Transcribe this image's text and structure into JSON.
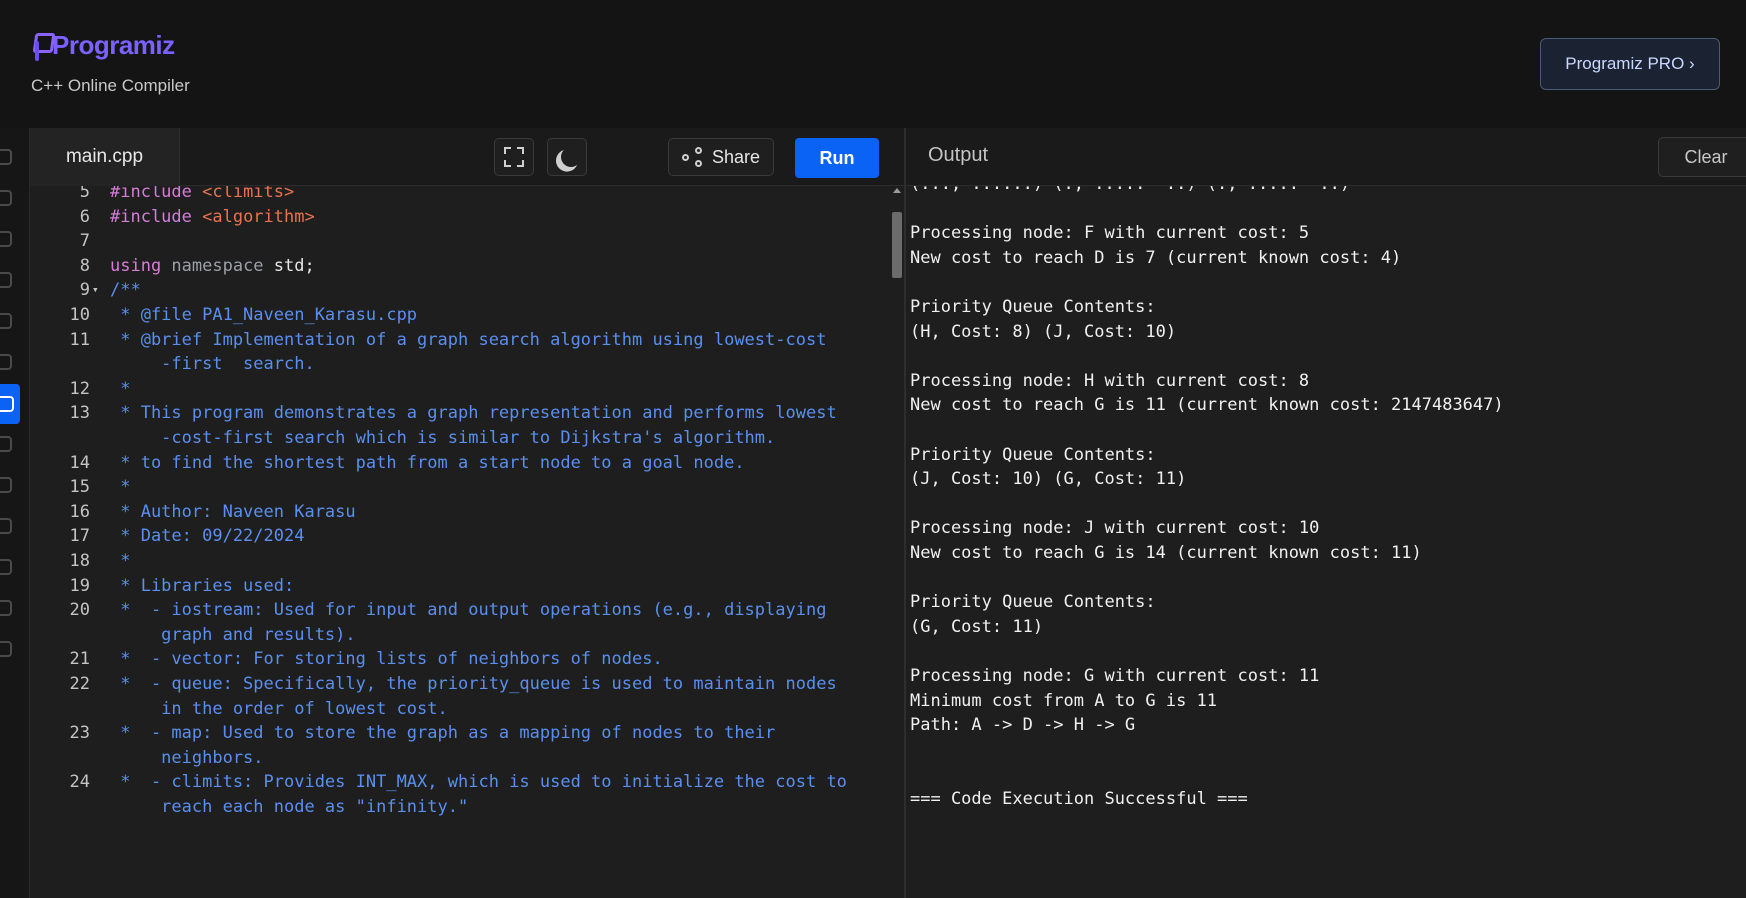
{
  "header": {
    "logo_text": "Programiz",
    "subtitle": "C++ Online Compiler",
    "pro_button": "Programiz PRO ›"
  },
  "editor": {
    "file_tab": "main.cpp",
    "share_label": "Share",
    "run_label": "Run",
    "lines": [
      {
        "n": "5",
        "fold": "",
        "parts": [
          {
            "c": "kw",
            "t": "#include "
          },
          {
            "c": "str",
            "t": "<climits>"
          }
        ]
      },
      {
        "n": "6",
        "fold": "",
        "parts": [
          {
            "c": "kw",
            "t": "#include "
          },
          {
            "c": "str",
            "t": "<algorithm>"
          }
        ]
      },
      {
        "n": "7",
        "fold": "",
        "parts": []
      },
      {
        "n": "8",
        "fold": "",
        "parts": [
          {
            "c": "kw",
            "t": "using "
          },
          {
            "c": "ns",
            "t": "namespace "
          },
          {
            "c": "plain",
            "t": "std;"
          }
        ]
      },
      {
        "n": "9",
        "fold": "▾",
        "parts": [
          {
            "c": "cmt",
            "t": "/**"
          }
        ]
      },
      {
        "n": "10",
        "fold": "",
        "parts": [
          {
            "c": "cmt",
            "t": " * @file PA1_Naveen_Karasu.cpp"
          }
        ]
      },
      {
        "n": "11",
        "fold": "",
        "parts": [
          {
            "c": "cmt",
            "t": " * @brief Implementation of a graph search algorithm using lowest-cost"
          }
        ]
      },
      {
        "n": "",
        "fold": "",
        "parts": [
          {
            "c": "cmt",
            "t": "     -first  search."
          }
        ]
      },
      {
        "n": "12",
        "fold": "",
        "parts": [
          {
            "c": "cmt",
            "t": " *"
          }
        ]
      },
      {
        "n": "13",
        "fold": "",
        "parts": [
          {
            "c": "cmt",
            "t": " * This program demonstrates a graph representation and performs lowest"
          }
        ]
      },
      {
        "n": "",
        "fold": "",
        "parts": [
          {
            "c": "cmt",
            "t": "     -cost-first search which is similar to Dijkstra's algorithm."
          }
        ]
      },
      {
        "n": "14",
        "fold": "",
        "parts": [
          {
            "c": "cmt",
            "t": " * to find the shortest path from a start node to a goal node."
          }
        ]
      },
      {
        "n": "15",
        "fold": "",
        "parts": [
          {
            "c": "cmt",
            "t": " *"
          }
        ]
      },
      {
        "n": "16",
        "fold": "",
        "parts": [
          {
            "c": "cmt",
            "t": " * Author: Naveen Karasu"
          }
        ]
      },
      {
        "n": "17",
        "fold": "",
        "parts": [
          {
            "c": "cmt",
            "t": " * Date: 09/22/2024"
          }
        ]
      },
      {
        "n": "18",
        "fold": "",
        "parts": [
          {
            "c": "cmt",
            "t": " *"
          }
        ]
      },
      {
        "n": "19",
        "fold": "",
        "parts": [
          {
            "c": "cmt",
            "t": " * Libraries used:"
          }
        ]
      },
      {
        "n": "20",
        "fold": "",
        "parts": [
          {
            "c": "cmt",
            "t": " *  - iostream: Used for input and output operations (e.g., displaying"
          }
        ]
      },
      {
        "n": "",
        "fold": "",
        "parts": [
          {
            "c": "cmt",
            "t": "     graph and results)."
          }
        ]
      },
      {
        "n": "21",
        "fold": "",
        "parts": [
          {
            "c": "cmt",
            "t": " *  - vector: For storing lists of neighbors of nodes."
          }
        ]
      },
      {
        "n": "22",
        "fold": "",
        "parts": [
          {
            "c": "cmt",
            "t": " *  - queue: Specifically, the priority_queue is used to maintain nodes"
          }
        ]
      },
      {
        "n": "",
        "fold": "",
        "parts": [
          {
            "c": "cmt",
            "t": "     in the order of lowest cost."
          }
        ]
      },
      {
        "n": "23",
        "fold": "",
        "parts": [
          {
            "c": "cmt",
            "t": " *  - map: Used to store the graph as a mapping of nodes to their"
          }
        ]
      },
      {
        "n": "",
        "fold": "",
        "parts": [
          {
            "c": "cmt",
            "t": "     neighbors."
          }
        ]
      },
      {
        "n": "24",
        "fold": "",
        "parts": [
          {
            "c": "cmt",
            "t": " *  - climits: Provides INT_MAX, which is used to initialize the cost to"
          }
        ]
      },
      {
        "n": "",
        "fold": "",
        "parts": [
          {
            "c": "cmt",
            "t": "     reach each node as \"infinity.\""
          }
        ]
      }
    ]
  },
  "output": {
    "title": "Output",
    "clear_label": "Clear",
    "lines": [
      "(..., ......) (., .....  ..) (., .....  ..)",
      "",
      "Processing node: F with current cost: 5",
      "New cost to reach D is 7 (current known cost: 4)",
      "",
      "Priority Queue Contents:",
      "(H, Cost: 8) (J, Cost: 10)",
      "",
      "Processing node: H with current cost: 8",
      "New cost to reach G is 11 (current known cost: 2147483647)",
      "",
      "Priority Queue Contents:",
      "(J, Cost: 10) (G, Cost: 11)",
      "",
      "Processing node: J with current cost: 10",
      "New cost to reach G is 14 (current known cost: 11)",
      "",
      "Priority Queue Contents:",
      "(G, Cost: 11)",
      "",
      "Processing node: G with current cost: 11",
      "Minimum cost from A to G is 11",
      "Path: A -> D -> H -> G",
      "",
      "",
      "=== Code Execution Successful ==="
    ]
  },
  "rail": {
    "icons": [
      "python-icon",
      "r-icon",
      "sql-icon",
      "html-icon",
      "java-icon",
      "c-icon",
      "cpp-icon",
      "csharp-icon",
      "js-icon",
      "go-icon",
      "php-icon",
      "swift-icon",
      "rust-icon"
    ]
  }
}
